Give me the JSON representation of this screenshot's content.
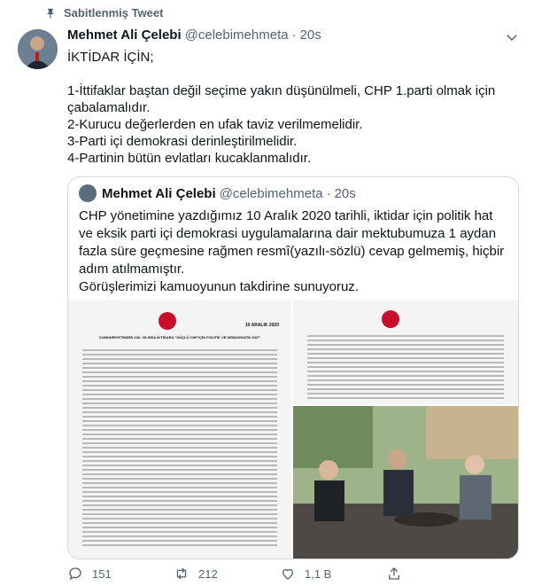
{
  "pinned": {
    "label": "Sabitlenmiş Tweet"
  },
  "tweet": {
    "name": "Mehmet Ali Çelebi",
    "handle": "@celebimehmeta",
    "separator": "·",
    "time": "20s",
    "lines": [
      "İKTİDAR İÇİN;",
      "",
      "1-İttifaklar baştan değil seçime yakın düşünülmeli, CHP 1.parti olmak için çabalamalıdır.",
      "2-Kurucu değerlerden en ufak taviz verilmemelidir.",
      "3-Parti içi demokrasi derinleştirilmelidir.",
      "4-Partinin bütün evlatları kucaklanmalıdır."
    ]
  },
  "quoted": {
    "name": "Mehmet Ali Çelebi",
    "handle": "@celebimehmeta",
    "separator": "·",
    "time": "20s",
    "text_1": "CHP yönetimine yazdığımız 10 Aralık 2020 tarihli, iktidar için politik hat ve eksik parti içi demokrasi uygulamalarına dair mektubumuza 1 aydan fazla süre geçmesine rağmen resmî(yazılı-sözlü) cevap gelmemiş, hiçbir adım atılmamıştır.",
    "text_2": "Görüşlerimizi kamuoyunun takdirine sunuyoruz.",
    "doc_date": "10 ARALIK 2020",
    "doc_title": "CUMHURİYETİMİZİN 100. YILINDA İKTİDARA \"GÜÇLÜ CHP İÇİN POLİTİK VE DEMOKRATİK HAT\""
  },
  "actions": {
    "replies": "151",
    "retweets": "212",
    "likes": "1,1 B"
  },
  "colors": {
    "secondary": "#536471",
    "border": "#cfd9de",
    "chp_red": "#c8102e"
  },
  "icons": [
    "pin-icon",
    "chevron-down-icon",
    "reply-icon",
    "retweet-icon",
    "like-icon",
    "share-icon"
  ]
}
